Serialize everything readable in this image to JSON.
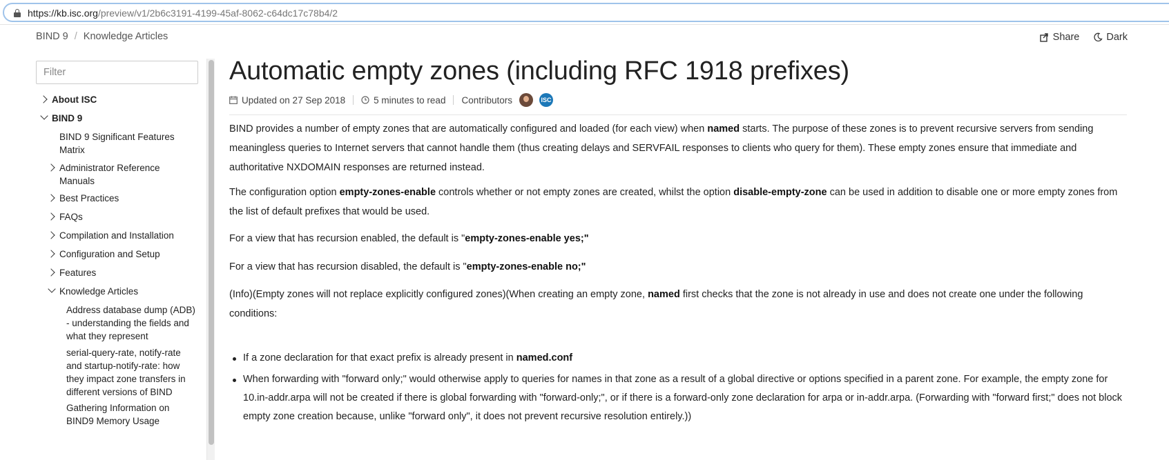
{
  "browser": {
    "url_host": "https://kb.isc.org",
    "url_rest": "/preview/v1/2b6c3191-4199-45af-8062-c64dc17c78b4/2"
  },
  "breadcrumb": [
    "BIND 9",
    "Knowledge Articles"
  ],
  "header_actions": {
    "share": "Share",
    "dark": "Dark"
  },
  "sidebar": {
    "filter_placeholder": "Filter",
    "items": [
      {
        "label": "About ISC",
        "chevron": "right"
      },
      {
        "label": "BIND 9",
        "chevron": "down"
      },
      {
        "label": "BIND 9 Significant Features Matrix",
        "chevron": ""
      },
      {
        "label": "Administrator Reference Manuals",
        "chevron": "right"
      },
      {
        "label": "Best Practices",
        "chevron": "right"
      },
      {
        "label": "FAQs",
        "chevron": "right"
      },
      {
        "label": "Compilation and Installation",
        "chevron": "right"
      },
      {
        "label": "Configuration and Setup",
        "chevron": "right"
      },
      {
        "label": "Features",
        "chevron": "right"
      },
      {
        "label": "Knowledge Articles",
        "chevron": "down"
      },
      {
        "label": "Address database dump (ADB) - understanding the fields and what they represent",
        "chevron": ""
      },
      {
        "label": "serial-query-rate, notify-rate and startup-notify-rate: how they impact zone transfers in different versions of BIND",
        "chevron": ""
      },
      {
        "label": "Gathering Information on BIND9 Memory Usage",
        "chevron": ""
      }
    ]
  },
  "article": {
    "title": "Automatic empty zones (including RFC 1918 prefixes)",
    "updated": "Updated on 27 Sep 2018",
    "read_time": "5 minutes to read",
    "contributors_label": "Contributors",
    "avatar2_text": "ISC",
    "p1": {
      "a": "BIND provides a number of empty zones that are automatically configured and loaded (for each view) when ",
      "b": "named",
      "c": " starts. The purpose of these zones is to prevent recursive servers from sending meaningless queries to Internet servers that cannot handle them (thus creating delays and SERVFAIL responses to clients who query for them). These empty zones ensure that immediate and authoritative NXDOMAIN responses are returned instead."
    },
    "p2": {
      "a": "The configuration option ",
      "b": "empty-zones-enable",
      "c": " controls whether or not empty zones are created, whilst the option ",
      "d": "disable-empty-zone",
      "e": " can be used in addition to disable one or more empty zones from the list of default prefixes that would be used."
    },
    "p3": {
      "a": "For a view that has recursion enabled, the default is \"",
      "b": "empty-zones-enable yes;\""
    },
    "p4": {
      "a": "For a view that has recursion disabled, the default is \"",
      "b": "empty-zones-enable no;\""
    },
    "p5": {
      "a": "(Info)(Empty zones will not replace explicitly configured zones)(When creating an empty zone, ",
      "b": "named",
      "c": " first checks that the zone is not already in use and does not create one under the following conditions:"
    },
    "bullets": [
      {
        "a": "If a zone declaration for that exact prefix is already present in ",
        "b": "named.conf"
      },
      {
        "a": "When forwarding with \"forward only;\" would otherwise apply to queries for names in that zone as a result of a global directive or options specified in a parent zone. For example, the empty zone for 10.in-addr.arpa will not be created if there is global forwarding with \"forward-only;\", or if there is a forward-only zone declaration for arpa or in-addr.arpa. (Forwarding with \"forward first;\" does not block empty zone creation because, unlike \"forward only\", it does not prevent recursive resolution entirely.))"
      }
    ]
  }
}
